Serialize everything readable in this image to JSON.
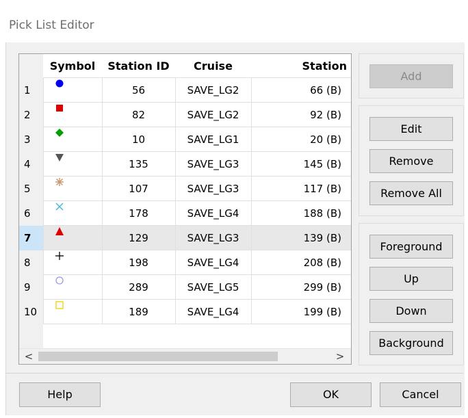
{
  "window": {
    "title": "Pick List Editor"
  },
  "grid": {
    "columns": [
      "Symbol",
      "Station ID",
      "Cruise",
      "Station"
    ],
    "selected_row": 7,
    "rows": [
      {
        "num": "1",
        "symbol": "circle-filled-blue",
        "station_id": "56",
        "cruise": "SAVE_LG2",
        "station": "66 (B)"
      },
      {
        "num": "2",
        "symbol": "square-filled-red",
        "station_id": "82",
        "cruise": "SAVE_LG2",
        "station": "92 (B)"
      },
      {
        "num": "3",
        "symbol": "diamond-filled-green",
        "station_id": "10",
        "cruise": "SAVE_LG1",
        "station": "20 (B)"
      },
      {
        "num": "4",
        "symbol": "triangle-down-gray",
        "station_id": "135",
        "cruise": "SAVE_LG3",
        "station": "145 (B)"
      },
      {
        "num": "5",
        "symbol": "asterisk-tan",
        "station_id": "107",
        "cruise": "SAVE_LG3",
        "station": "117 (B)"
      },
      {
        "num": "6",
        "symbol": "x-cross-cyan",
        "station_id": "178",
        "cruise": "SAVE_LG4",
        "station": "188 (B)"
      },
      {
        "num": "7",
        "symbol": "triangle-up-red",
        "station_id": "129",
        "cruise": "SAVE_LG3",
        "station": "139 (B)"
      },
      {
        "num": "8",
        "symbol": "plus-black",
        "station_id": "198",
        "cruise": "SAVE_LG4",
        "station": "208 (B)"
      },
      {
        "num": "9",
        "symbol": "circle-open-lavender",
        "station_id": "289",
        "cruise": "SAVE_LG5",
        "station": "299 (B)"
      },
      {
        "num": "10",
        "symbol": "square-open-yellow",
        "station_id": "189",
        "cruise": "SAVE_LG4",
        "station": "199 (B)"
      }
    ],
    "scroll_left_icon": "chevron-left-icon",
    "scroll_right_icon": "chevron-right-icon"
  },
  "buttons": {
    "add": "Add",
    "edit": "Edit",
    "remove": "Remove",
    "remove_all": "Remove All",
    "foreground": "Foreground",
    "up": "Up",
    "down": "Down",
    "background": "Background",
    "help": "Help",
    "ok": "OK",
    "cancel": "Cancel"
  },
  "colors": {
    "blue": "#0000ee",
    "red": "#dd0000",
    "green": "#00a000",
    "gray": "#555555",
    "tan": "#c8966e",
    "cyan": "#40b8d8",
    "lavender": "#9a9ae0",
    "yellow": "#f0d000",
    "selection": "#cce4f7"
  }
}
